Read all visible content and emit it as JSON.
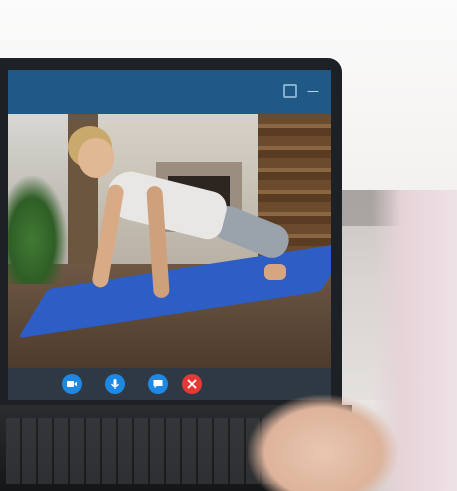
{
  "scene": {
    "description_icons": [
      "maximize-icon",
      "minimize-icon"
    ]
  },
  "call_controls": [
    {
      "name": "video-camera-icon",
      "color": "#1e88e5"
    },
    {
      "name": "microphone-icon",
      "color": "#1e88e5"
    },
    {
      "name": "chat-icon",
      "color": "#1e88e5"
    },
    {
      "name": "end-call-icon",
      "color": "#e53935"
    }
  ],
  "colors": {
    "titlebar": "#1f5a86",
    "mat": "#2d5ec6",
    "end_call": "#e53935",
    "control_blue": "#1e88e5"
  }
}
